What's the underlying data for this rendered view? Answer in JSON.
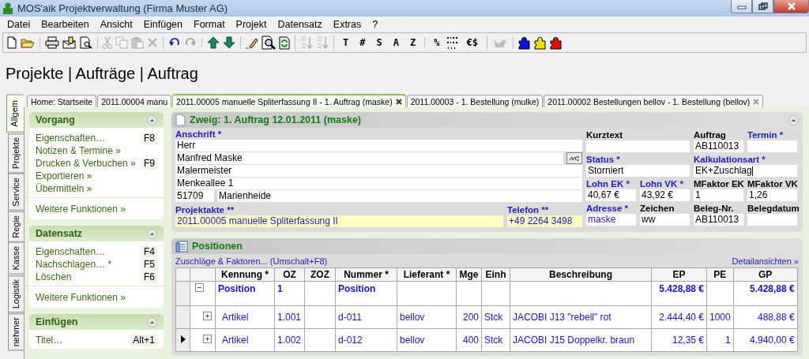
{
  "window": {
    "title": "MOS'aik Projektverwaltung (Firma Muster AG)"
  },
  "menu": [
    "Datei",
    "Bearbeiten",
    "Ansicht",
    "Einfügen",
    "Format",
    "Projekt",
    "Datensatz",
    "Extras",
    "?"
  ],
  "toolbar": [
    [
      {
        "kind": "icon",
        "disabled": false
      },
      {
        "kind": "icon",
        "disabled": false
      }
    ],
    [
      {
        "kind": "icon",
        "disabled": false
      },
      {
        "kind": "icon",
        "disabled": false
      },
      {
        "kind": "icon",
        "disabled": false
      }
    ],
    [
      {
        "kind": "icon",
        "disabled": true
      },
      {
        "kind": "icon",
        "disabled": true
      },
      {
        "kind": "icon",
        "disabled": true
      },
      {
        "kind": "icon",
        "disabled": true
      }
    ],
    [
      {
        "kind": "icon",
        "disabled": false
      },
      {
        "kind": "icon",
        "disabled": true
      }
    ],
    [
      {
        "kind": "icon",
        "disabled": false
      },
      {
        "kind": "icon",
        "disabled": false
      }
    ],
    [
      {
        "kind": "icon",
        "disabled": false
      },
      {
        "kind": "icon",
        "disabled": false
      },
      {
        "kind": "icon",
        "disabled": false
      }
    ],
    [
      {
        "kind": "icon",
        "disabled": true
      },
      {
        "kind": "icon",
        "disabled": true
      }
    ],
    [
      {
        "kind": "text",
        "label": "T"
      },
      {
        "kind": "text",
        "label": "#"
      },
      {
        "kind": "text",
        "label": "S"
      },
      {
        "kind": "text",
        "label": "A"
      },
      {
        "kind": "text",
        "label": "Z"
      }
    ],
    [
      {
        "kind": "text",
        "label": "%"
      },
      {
        "kind": "icon",
        "disabled": false
      },
      {
        "kind": "text",
        "label": "€$"
      }
    ],
    [
      {
        "kind": "icon",
        "disabled": true
      }
    ],
    [
      {
        "kind": "icon",
        "disabled": false
      },
      {
        "kind": "icon",
        "disabled": false
      },
      {
        "kind": "icon",
        "disabled": false
      }
    ]
  ],
  "breadcrumb": "Projekte | Aufträge | Auftrag",
  "side_tabs": [
    {
      "label": "Allgem",
      "selected": true
    },
    {
      "label": "Projekte",
      "selected": false
    },
    {
      "label": "Service",
      "selected": false
    },
    {
      "label": "Regie",
      "selected": false
    },
    {
      "label": "Kasse",
      "selected": false
    },
    {
      "label": "Logistik",
      "selected": false
    },
    {
      "label": "nehmer",
      "selected": false
    }
  ],
  "doc_tabs": [
    {
      "label": "Home: Startseite",
      "selected": false,
      "closable": false
    },
    {
      "label": "2011.00004 manu",
      "selected": false,
      "closable": false
    },
    {
      "label": "2011.00005 manuelle Spliterfassung II - 1. Auftrag (maske)",
      "selected": true,
      "closable": true
    },
    {
      "label": "2011.00003 - 1. Bestellung (mulke)",
      "selected": false,
      "closable": false
    },
    {
      "label": "2011.00002 Bestellungen bellov - 1. Bestellung (bellov)",
      "selected": false,
      "closable": true
    }
  ],
  "sidebar": [
    {
      "title": "Vorgang",
      "expanded": true,
      "items": [
        {
          "label": "Eigenschaften…",
          "shortcut": "F8"
        },
        {
          "label": "Notizen & Termine »"
        },
        {
          "label": "Drucken & Verbuchen »",
          "shortcut": "F9"
        },
        {
          "label": "Exportieren »"
        },
        {
          "label": "Übermitteln »"
        }
      ],
      "more": "Weitere Funktionen »"
    },
    {
      "title": "Datensatz",
      "expanded": true,
      "items": [
        {
          "label": "Eigenschaften…",
          "shortcut": "F4"
        },
        {
          "label": "Nachschlagen… *",
          "shortcut": "F5"
        },
        {
          "label": "Löschen",
          "shortcut": "F6"
        }
      ],
      "more": "Weitere Funktionen »"
    },
    {
      "title": "Einfügen",
      "expanded": true,
      "items": [
        {
          "label": "Titel…",
          "shortcut": "Alt+1"
        }
      ]
    }
  ],
  "record": {
    "title": "Zweig: 1. Auftrag 12.01.2011 (maske)",
    "expanded": true,
    "address": {
      "label": "Anschrift *",
      "mandatory": true,
      "lines": [
        "Herr",
        "Manfred Maske",
        "Malermeister",
        "Menkeallee 1"
      ],
      "postcode": "51709",
      "city": "Marienheide"
    },
    "rows": [
      {
        "fields": [
          {
            "label": "Kurztext",
            "kind": "wide",
            "mandatory": false
          },
          {
            "label": "Auftrag",
            "kind": "narrow",
            "mandatory": false,
            "value": "AB110013"
          },
          {
            "label": "Termin *",
            "kind": "narrow",
            "mandatory": true
          }
        ]
      },
      {
        "fields": [
          {
            "label": "Status *",
            "kind": "wide",
            "mandatory": true,
            "value": "Storniert"
          },
          {
            "label": "Kalkulationsart *",
            "kind": "wide",
            "mandatory": true,
            "value": "EK+Zuschlag",
            "focused": true
          }
        ]
      },
      {
        "fields": [
          {
            "label": "Lohn EK *",
            "kind": "narrow",
            "mandatory": true,
            "value": "40,67 €"
          },
          {
            "label": "Lohn VK *",
            "kind": "narrow",
            "mandatory": true,
            "value": "43,92 €"
          },
          {
            "label": "MFaktor EK",
            "kind": "narrow",
            "mandatory": false,
            "value": "1"
          },
          {
            "label": "MFaktor VK",
            "kind": "narrow",
            "mandatory": false,
            "value": "1,26"
          }
        ]
      }
    ],
    "bottom_left": [
      {
        "label": "Projektakte **",
        "kind": "long",
        "mandatory": true,
        "highlighted": true,
        "value": "2011.00005 manuelle Spliterfassung II"
      },
      {
        "label": "Telefon **",
        "kind": "medium",
        "mandatory": true,
        "highlighted": true,
        "value": "+49 2264 3498"
      }
    ],
    "bottom_right": [
      {
        "label": "Adresse *",
        "kind": "narrow",
        "mandatory": true,
        "linked": true,
        "value": "maske"
      },
      {
        "label": "Zeichen",
        "kind": "narrow",
        "mandatory": false,
        "value": "ww"
      },
      {
        "label": "Beleg-Nr.",
        "kind": "narrow",
        "mandatory": false,
        "value": "AB110013"
      },
      {
        "label": "Belegdatum",
        "kind": "narrow",
        "mandatory": false
      }
    ]
  },
  "positions": {
    "title": "Positionen",
    "expanded": true,
    "link_left": "Zuschläge & Faktoren... (Umschalt+F8)",
    "link_right": "Detailansichten »",
    "columns": [
      "Kennung *",
      "OZ",
      "ZOZ",
      "Nummer *",
      "Lieferant *",
      "Mge",
      "Einh",
      "Beschreibung",
      "EP",
      "PE",
      "GP"
    ],
    "rows": [
      {
        "kind": "group",
        "selected": false,
        "expanded": true,
        "cells": [
          "Position",
          "1",
          null,
          "Position",
          null,
          null,
          null,
          null,
          "5.428,88 €",
          null,
          "5.428,88 €"
        ]
      },
      {
        "kind": "item",
        "selected": false,
        "expanded": false,
        "cells": [
          "Artikel",
          "1.001",
          null,
          "d-011",
          "bellov",
          "200",
          "Stck",
          "JACOBI J13 \"rebell\" rot",
          "2.444,40 €",
          "1000",
          "488,88 €"
        ]
      },
      {
        "kind": "item",
        "selected": true,
        "expanded": false,
        "cells": [
          "Artikel",
          "1.002",
          null,
          "d-012",
          "bellov",
          "400",
          "Stck",
          "JACOBI J15 Doppelkr. braun",
          "12,35 €",
          "1",
          "4.940,00 €"
        ]
      }
    ]
  }
}
